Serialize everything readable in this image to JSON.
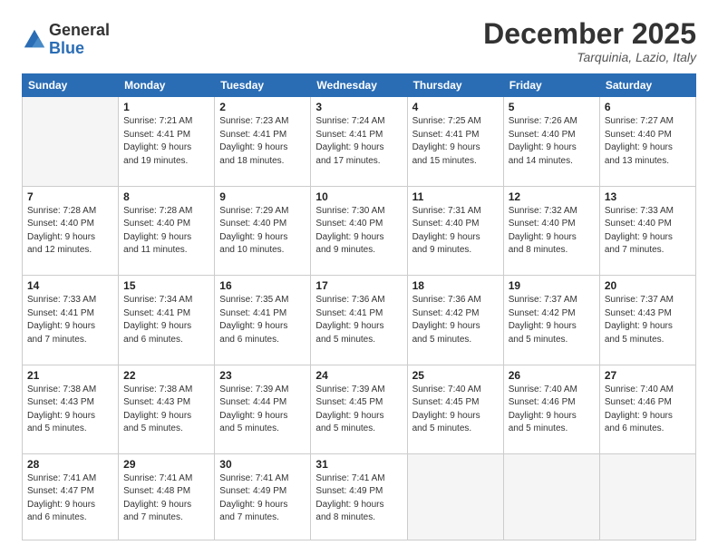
{
  "logo": {
    "general": "General",
    "blue": "Blue"
  },
  "header": {
    "month": "December 2025",
    "location": "Tarquinia, Lazio, Italy"
  },
  "weekdays": [
    "Sunday",
    "Monday",
    "Tuesday",
    "Wednesday",
    "Thursday",
    "Friday",
    "Saturday"
  ],
  "weeks": [
    [
      {
        "day": "",
        "info": ""
      },
      {
        "day": "1",
        "info": "Sunrise: 7:21 AM\nSunset: 4:41 PM\nDaylight: 9 hours\nand 19 minutes."
      },
      {
        "day": "2",
        "info": "Sunrise: 7:23 AM\nSunset: 4:41 PM\nDaylight: 9 hours\nand 18 minutes."
      },
      {
        "day": "3",
        "info": "Sunrise: 7:24 AM\nSunset: 4:41 PM\nDaylight: 9 hours\nand 17 minutes."
      },
      {
        "day": "4",
        "info": "Sunrise: 7:25 AM\nSunset: 4:41 PM\nDaylight: 9 hours\nand 15 minutes."
      },
      {
        "day": "5",
        "info": "Sunrise: 7:26 AM\nSunset: 4:40 PM\nDaylight: 9 hours\nand 14 minutes."
      },
      {
        "day": "6",
        "info": "Sunrise: 7:27 AM\nSunset: 4:40 PM\nDaylight: 9 hours\nand 13 minutes."
      }
    ],
    [
      {
        "day": "7",
        "info": "Sunrise: 7:28 AM\nSunset: 4:40 PM\nDaylight: 9 hours\nand 12 minutes."
      },
      {
        "day": "8",
        "info": "Sunrise: 7:28 AM\nSunset: 4:40 PM\nDaylight: 9 hours\nand 11 minutes."
      },
      {
        "day": "9",
        "info": "Sunrise: 7:29 AM\nSunset: 4:40 PM\nDaylight: 9 hours\nand 10 minutes."
      },
      {
        "day": "10",
        "info": "Sunrise: 7:30 AM\nSunset: 4:40 PM\nDaylight: 9 hours\nand 9 minutes."
      },
      {
        "day": "11",
        "info": "Sunrise: 7:31 AM\nSunset: 4:40 PM\nDaylight: 9 hours\nand 9 minutes."
      },
      {
        "day": "12",
        "info": "Sunrise: 7:32 AM\nSunset: 4:40 PM\nDaylight: 9 hours\nand 8 minutes."
      },
      {
        "day": "13",
        "info": "Sunrise: 7:33 AM\nSunset: 4:40 PM\nDaylight: 9 hours\nand 7 minutes."
      }
    ],
    [
      {
        "day": "14",
        "info": "Sunrise: 7:33 AM\nSunset: 4:41 PM\nDaylight: 9 hours\nand 7 minutes."
      },
      {
        "day": "15",
        "info": "Sunrise: 7:34 AM\nSunset: 4:41 PM\nDaylight: 9 hours\nand 6 minutes."
      },
      {
        "day": "16",
        "info": "Sunrise: 7:35 AM\nSunset: 4:41 PM\nDaylight: 9 hours\nand 6 minutes."
      },
      {
        "day": "17",
        "info": "Sunrise: 7:36 AM\nSunset: 4:41 PM\nDaylight: 9 hours\nand 5 minutes."
      },
      {
        "day": "18",
        "info": "Sunrise: 7:36 AM\nSunset: 4:42 PM\nDaylight: 9 hours\nand 5 minutes."
      },
      {
        "day": "19",
        "info": "Sunrise: 7:37 AM\nSunset: 4:42 PM\nDaylight: 9 hours\nand 5 minutes."
      },
      {
        "day": "20",
        "info": "Sunrise: 7:37 AM\nSunset: 4:43 PM\nDaylight: 9 hours\nand 5 minutes."
      }
    ],
    [
      {
        "day": "21",
        "info": "Sunrise: 7:38 AM\nSunset: 4:43 PM\nDaylight: 9 hours\nand 5 minutes."
      },
      {
        "day": "22",
        "info": "Sunrise: 7:38 AM\nSunset: 4:43 PM\nDaylight: 9 hours\nand 5 minutes."
      },
      {
        "day": "23",
        "info": "Sunrise: 7:39 AM\nSunset: 4:44 PM\nDaylight: 9 hours\nand 5 minutes."
      },
      {
        "day": "24",
        "info": "Sunrise: 7:39 AM\nSunset: 4:45 PM\nDaylight: 9 hours\nand 5 minutes."
      },
      {
        "day": "25",
        "info": "Sunrise: 7:40 AM\nSunset: 4:45 PM\nDaylight: 9 hours\nand 5 minutes."
      },
      {
        "day": "26",
        "info": "Sunrise: 7:40 AM\nSunset: 4:46 PM\nDaylight: 9 hours\nand 5 minutes."
      },
      {
        "day": "27",
        "info": "Sunrise: 7:40 AM\nSunset: 4:46 PM\nDaylight: 9 hours\nand 6 minutes."
      }
    ],
    [
      {
        "day": "28",
        "info": "Sunrise: 7:41 AM\nSunset: 4:47 PM\nDaylight: 9 hours\nand 6 minutes."
      },
      {
        "day": "29",
        "info": "Sunrise: 7:41 AM\nSunset: 4:48 PM\nDaylight: 9 hours\nand 7 minutes."
      },
      {
        "day": "30",
        "info": "Sunrise: 7:41 AM\nSunset: 4:49 PM\nDaylight: 9 hours\nand 7 minutes."
      },
      {
        "day": "31",
        "info": "Sunrise: 7:41 AM\nSunset: 4:49 PM\nDaylight: 9 hours\nand 8 minutes."
      },
      {
        "day": "",
        "info": ""
      },
      {
        "day": "",
        "info": ""
      },
      {
        "day": "",
        "info": ""
      }
    ]
  ]
}
